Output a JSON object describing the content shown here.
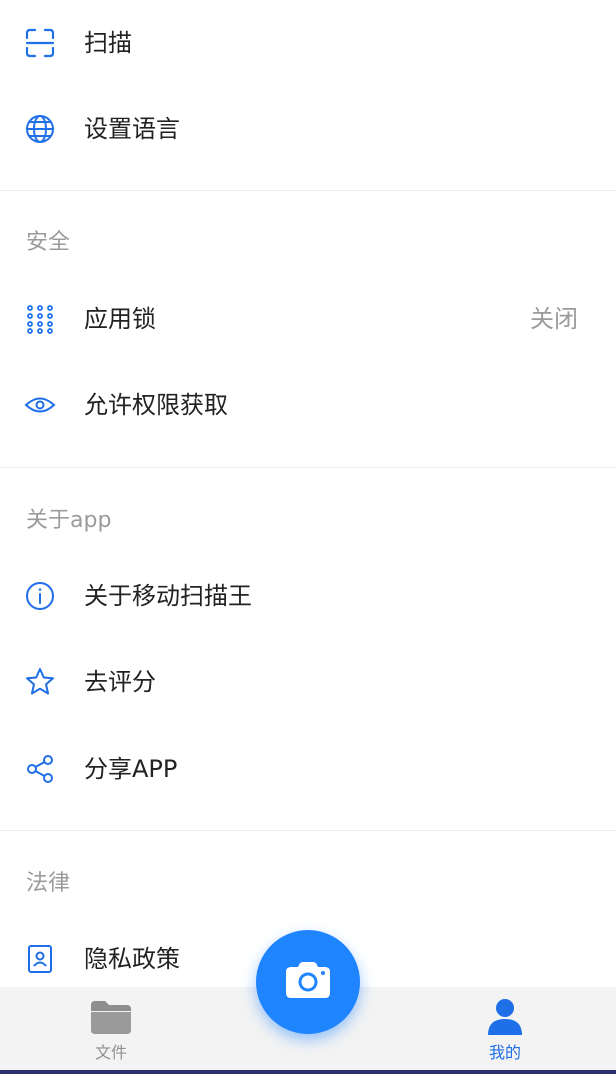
{
  "menu": {
    "scan_label": "扫描",
    "language_label": "设置语言",
    "security_title": "安全",
    "app_lock_label": "应用锁",
    "app_lock_value": "关闭",
    "permissions_label": "允许权限获取",
    "about_title": "关于app",
    "about_label": "关于移动扫描王",
    "rate_label": "去评分",
    "share_label": "分享APP",
    "legal_title": "法律",
    "privacy_label": "隐私政策"
  },
  "tabbar": {
    "files_label": "文件",
    "mine_label": "我的"
  },
  "colors": {
    "accent": "#1f84ff",
    "icon_blue": "#1e6fe8",
    "section_gray": "#9b9b9b",
    "tab_inactive": "#8f8f8f"
  },
  "icons": {
    "scan": "scan-frame-icon",
    "language": "globe-icon",
    "app_lock": "keypad-icon",
    "permissions": "eye-icon",
    "about": "info-icon",
    "rate": "star-icon",
    "share": "share-icon",
    "privacy": "contact-card-icon",
    "files": "folder-icon",
    "mine": "person-icon",
    "fab": "camera-icon"
  }
}
